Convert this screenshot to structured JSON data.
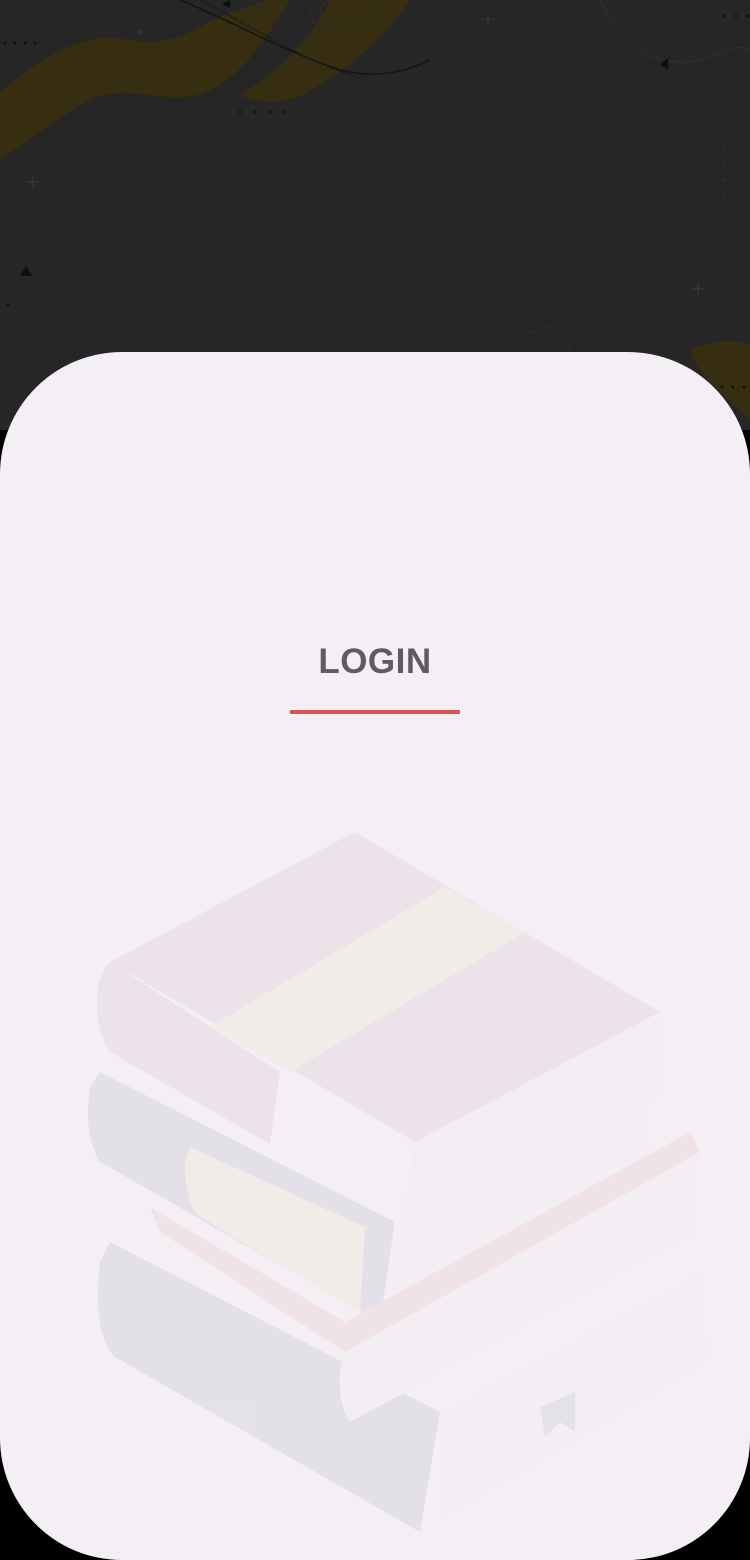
{
  "screen": {
    "background_color": "#262626",
    "accent_color": "#d9534f",
    "card_color": "#f3eff5",
    "decoration_color": "#b8860b"
  },
  "login": {
    "title": "LOGIN"
  },
  "illustration": {
    "icon": "stacked-books-illustration"
  }
}
